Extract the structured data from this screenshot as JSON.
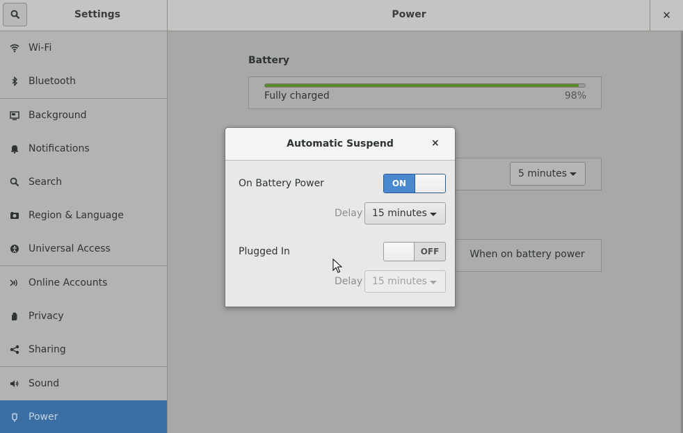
{
  "header": {
    "app_title": "Settings",
    "page_title": "Power",
    "close_symbol": "✕"
  },
  "sidebar": {
    "items": [
      {
        "label": "Wi-Fi",
        "icon": "wifi-icon"
      },
      {
        "label": "Bluetooth",
        "icon": "bluetooth-icon"
      },
      {
        "label": "Background",
        "icon": "background-icon"
      },
      {
        "label": "Notifications",
        "icon": "bell-icon"
      },
      {
        "label": "Search",
        "icon": "search-icon"
      },
      {
        "label": "Region & Language",
        "icon": "camera-icon"
      },
      {
        "label": "Universal Access",
        "icon": "accessibility-icon"
      },
      {
        "label": "Online Accounts",
        "icon": "online-accounts-icon"
      },
      {
        "label": "Privacy",
        "icon": "hand-icon"
      },
      {
        "label": "Sharing",
        "icon": "share-icon"
      },
      {
        "label": "Sound",
        "icon": "speaker-icon"
      },
      {
        "label": "Power",
        "icon": "power-icon",
        "active": true
      }
    ]
  },
  "main": {
    "battery_title": "Battery",
    "battery_status": "Fully charged",
    "battery_percent": "98%",
    "battery_level": 0.98,
    "blank_combo_value": "5 minutes",
    "button_when_on_battery": "When on battery power"
  },
  "dialog": {
    "title": "Automatic Suspend",
    "close_symbol": "×",
    "on_battery_label": "On Battery Power",
    "on_battery_switch": "ON",
    "delay_label_1": "Delay",
    "delay_value_1": "15 minutes",
    "plugged_in_label": "Plugged In",
    "plugged_in_switch": "OFF",
    "delay_label_2": "Delay",
    "delay_value_2": "15 minutes"
  },
  "colors": {
    "active_sidebar": "#3b6ea3",
    "switch_on": "#4a88cf",
    "battery_fill": "#5a8a2a"
  }
}
